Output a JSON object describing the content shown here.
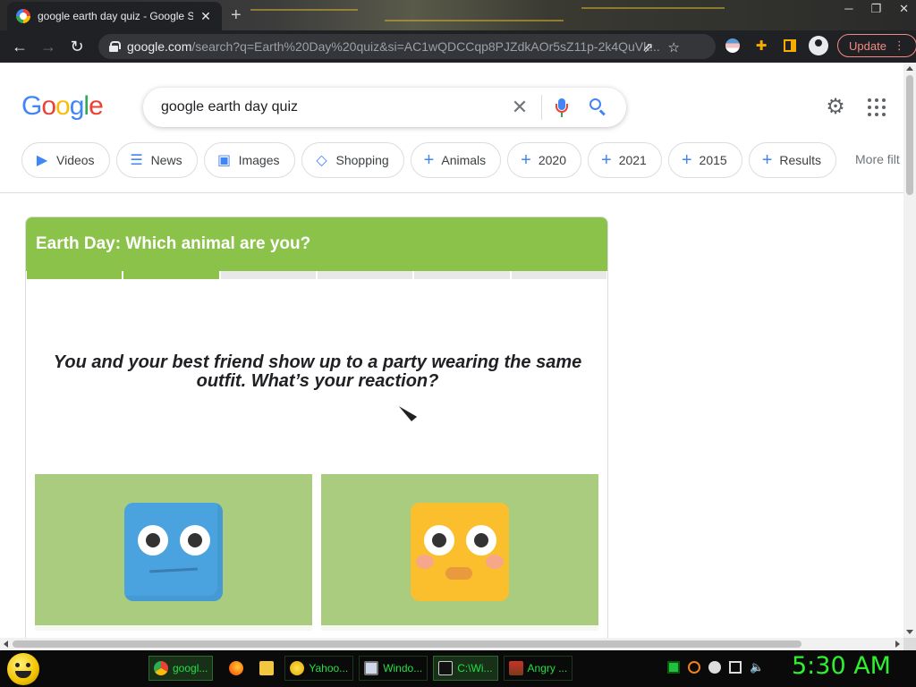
{
  "browser": {
    "tab_title": "google earth day quiz - Google S",
    "tab_close": "✕",
    "new_tab": "+",
    "url_host": "google.com",
    "url_rest": "/search?q=Earth%20Day%20quiz&si=AC1wQDCCqp8PJZdkAOr5sZ11p-2k4QuVk...",
    "update_label": "Update"
  },
  "google": {
    "logo_letters": [
      "G",
      "o",
      "o",
      "g",
      "l",
      "e"
    ],
    "logo_colors": [
      "#4285f4",
      "#ea4335",
      "#fbbc05",
      "#4285f4",
      "#34a853",
      "#ea4335"
    ],
    "query": "google earth day quiz",
    "chips": [
      {
        "label": "Videos",
        "icon": "video-icon"
      },
      {
        "label": "News",
        "icon": "news-icon"
      },
      {
        "label": "Images",
        "icon": "image-icon"
      },
      {
        "label": "Shopping",
        "icon": "tag-icon"
      },
      {
        "label": "Animals",
        "icon": "plus-icon"
      },
      {
        "label": "2020",
        "icon": "plus-icon"
      },
      {
        "label": "2021",
        "icon": "plus-icon"
      },
      {
        "label": "2015",
        "icon": "plus-icon"
      },
      {
        "label": "Results",
        "icon": "plus-icon"
      }
    ],
    "more_filters": "More filt"
  },
  "quiz": {
    "title": "Earth Day: Which animal are you?",
    "progress_segments": 6,
    "progress_done": 2,
    "question": "You and your best friend show up to a party wearing the same outfit. What’s your reaction?",
    "accent_color": "#8bc34a",
    "answers": [
      {
        "face": "blue-square-face",
        "color": "#4aa3df"
      },
      {
        "face": "yellow-square-face",
        "color": "#fbbf2d"
      }
    ]
  },
  "taskbar": {
    "items": [
      {
        "label": "googl...",
        "icon": "chrome-icon",
        "active": true
      },
      {
        "label": "",
        "icon": "firefox-icon",
        "active": false
      },
      {
        "label": "",
        "icon": "folder-icon",
        "active": false
      },
      {
        "label": "Yahoo...",
        "icon": "yahoo-messenger-icon",
        "active": false
      },
      {
        "label": "Windo...",
        "icon": "windows-icon",
        "active": false
      },
      {
        "label": "C:\\Wi...",
        "icon": "cmd-icon",
        "active": true
      },
      {
        "label": "Angry ...",
        "icon": "angry-birds-icon",
        "active": false
      }
    ],
    "clock": "5:30 AM"
  }
}
